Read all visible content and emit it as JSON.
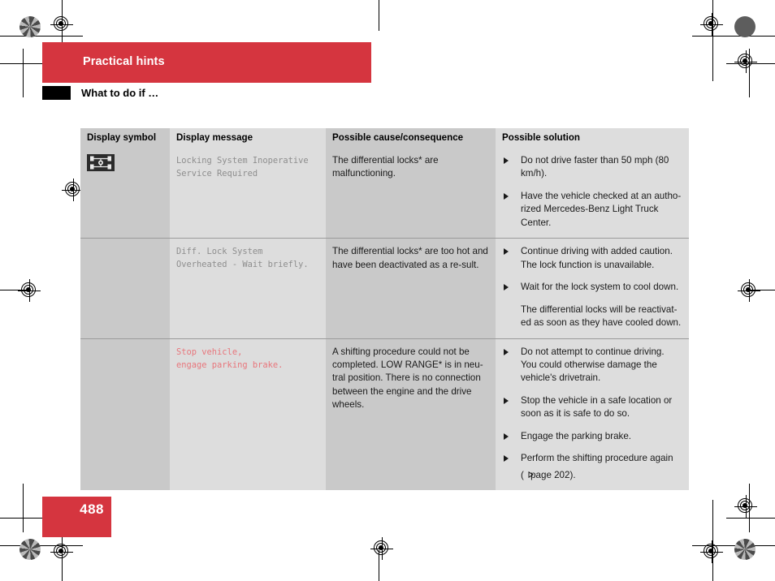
{
  "header": {
    "chapter": "Practical hints",
    "section": "What to do if …"
  },
  "footer": {
    "page_number": "488"
  },
  "colors": {
    "brand_red": "#d5353f",
    "alert_text": "#e8767c",
    "display_text": "#8e8e8e",
    "col_odd": "#c9c9c9",
    "col_even": "#dddddd"
  },
  "table": {
    "columns": [
      "Display symbol",
      "Display message",
      "Possible cause/consequence",
      "Possible solution"
    ],
    "rows": [
      {
        "symbol_icon": "differential-lock-symbol",
        "message": "Locking System Inoperative\nService Required",
        "message_alert": false,
        "cause": "The differential locks* are malfunctioning.",
        "solutions": [
          {
            "text": "Do not drive faster than 50 mph (80 km/h).",
            "bullet": true
          },
          {
            "text": "Have the vehicle checked at an autho-rized Mercedes-Benz Light Truck Center.",
            "bullet": true
          }
        ]
      },
      {
        "symbol_icon": "",
        "message": "Diff. Lock System\nOverheated - Wait briefly.",
        "message_alert": false,
        "cause": "The differential locks* are too hot and have been deactivated as a re-sult.",
        "solutions": [
          {
            "text": "Continue driving with added caution. The lock function is unavailable.",
            "bullet": true
          },
          {
            "text": "Wait for the lock system to cool down.",
            "bullet": true
          },
          {
            "text": "The differential locks will be reactivat-ed as soon as they have cooled down.",
            "bullet": false
          }
        ]
      },
      {
        "symbol_icon": "",
        "message": "Stop vehicle,\nengage parking brake.",
        "message_alert": true,
        "cause": "A shifting procedure could not be completed. LOW RANGE* is in neu-tral position. There is no connection between the engine and the drive wheels.",
        "solutions": [
          {
            "text": "Do not attempt to continue driving. You could otherwise damage the vehicle's drivetrain.",
            "bullet": true
          },
          {
            "text": "Stop the vehicle in a safe location or soon as it is safe to do so.",
            "bullet": true
          },
          {
            "text": "Engage the parking brake.",
            "bullet": true
          },
          {
            "text": "Perform the shifting procedure again",
            "bullet": true,
            "xref_prefix": "(",
            "xref_text": " page 202).",
            "xref_icon": "hollow-triangle-right-icon"
          }
        ]
      }
    ]
  }
}
